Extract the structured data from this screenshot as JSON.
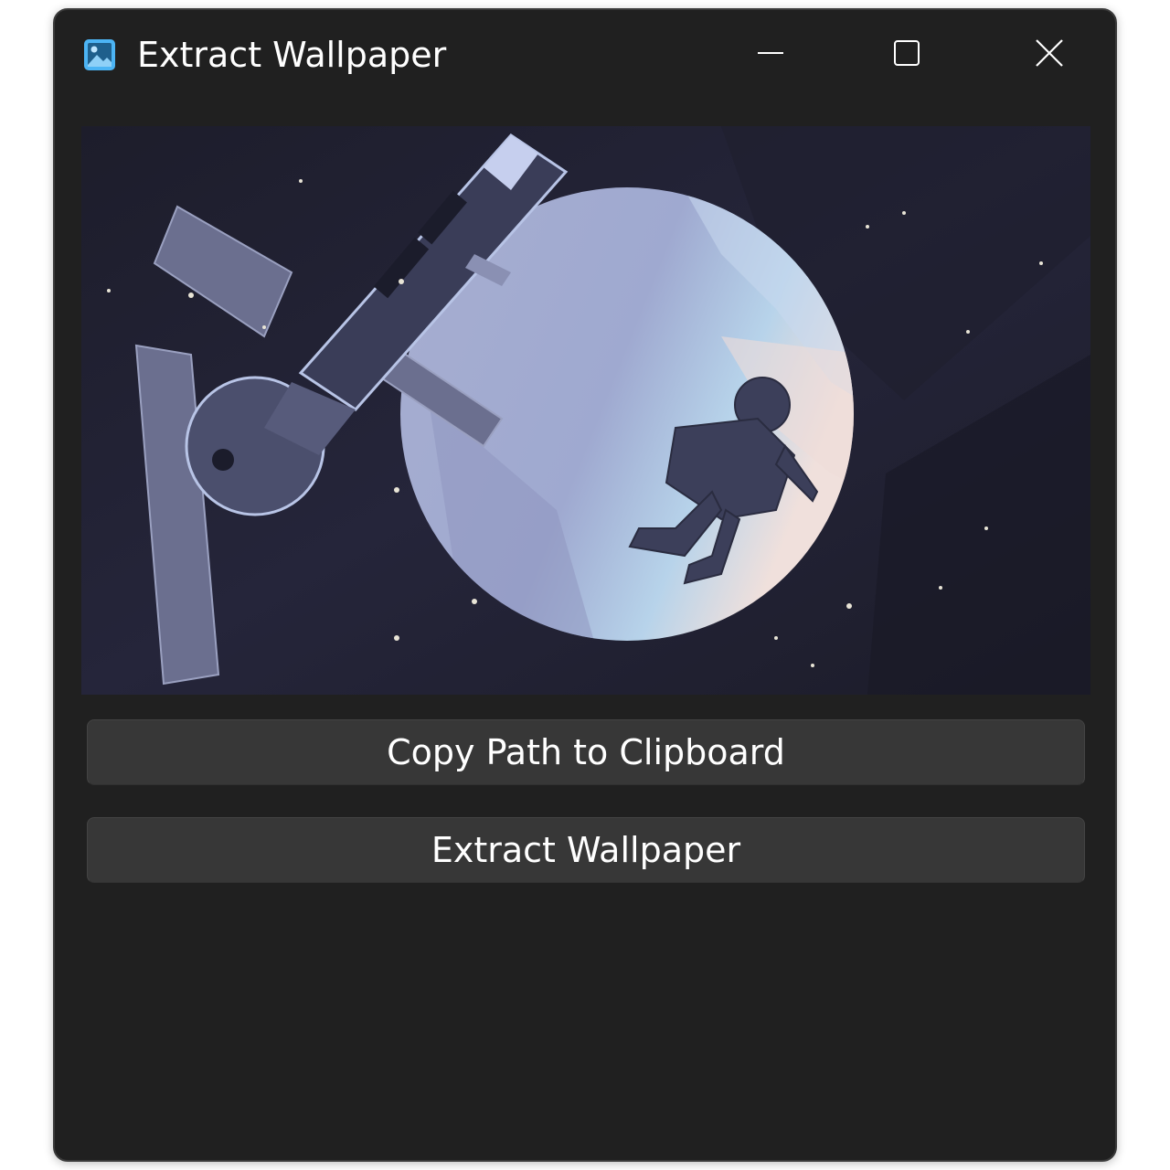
{
  "window": {
    "title": "Extract Wallpaper",
    "app_icon": "image-icon",
    "controls": {
      "minimize_icon": "minimize-icon",
      "maximize_icon": "maximize-icon",
      "close_icon": "close-icon"
    }
  },
  "preview": {
    "image_subject": "wallpaper-preview-image"
  },
  "buttons": {
    "copy_path_label": "Copy Path to Clipboard",
    "extract_label": "Extract Wallpaper"
  },
  "colors": {
    "window_bg": "#202020",
    "button_bg": "#373737",
    "text": "#ffffff",
    "icon_accent": "#4cb4f4"
  }
}
